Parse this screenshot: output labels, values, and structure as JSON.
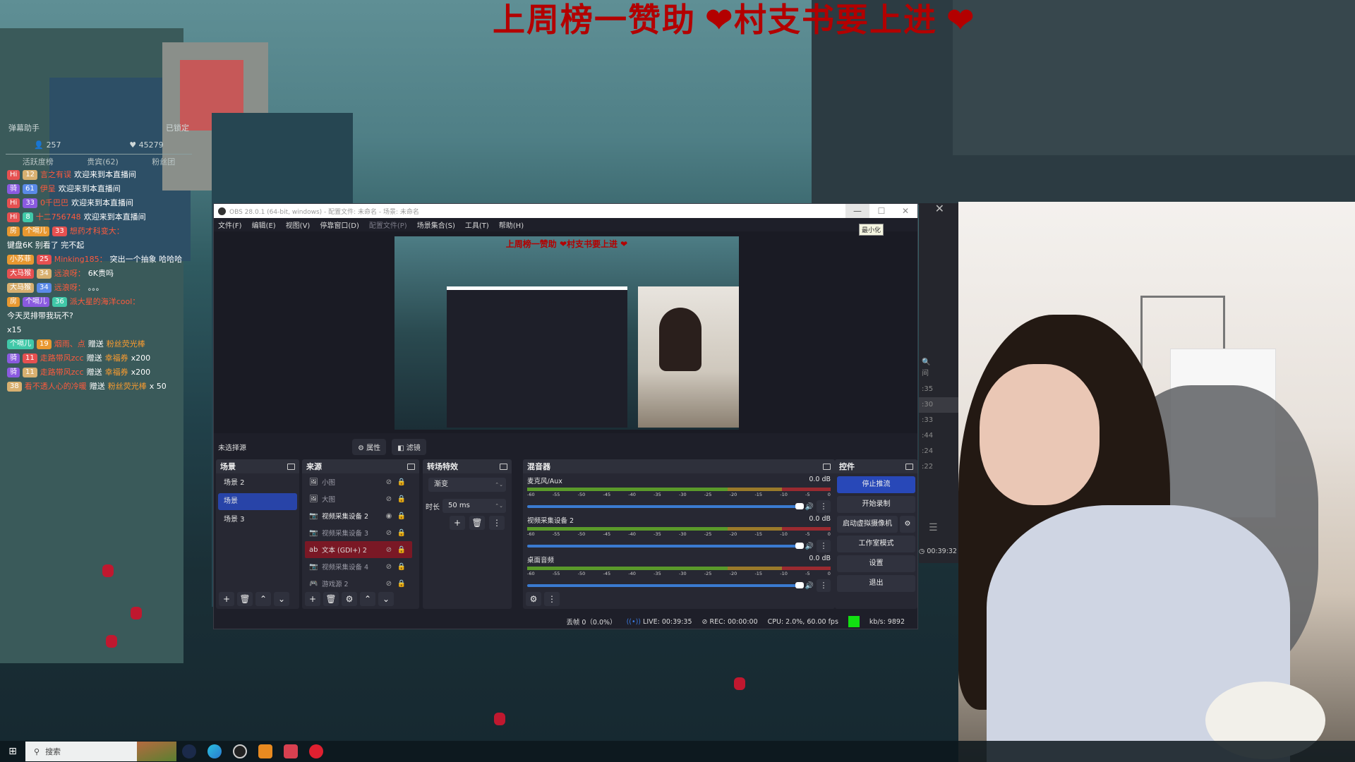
{
  "banner": {
    "text": "上周榜一赞助 ❤村支书要上进 ❤"
  },
  "chat": {
    "title": "弹幕助手",
    "lock_label": "已锁定",
    "stats": {
      "viewers": "257",
      "likes": "45279"
    },
    "tabs": [
      "活跃度榜",
      "贵宾(62)",
      "粉丝团"
    ],
    "messages": [
      {
        "badges": [
          "Hi",
          "12"
        ],
        "nick": "言之有误",
        "text": "欢迎来到本直播间"
      },
      {
        "badges": [
          "骑",
          "61"
        ],
        "nick": "伊呈",
        "text": "欢迎来到本直播间"
      },
      {
        "badges": [
          "Hi",
          "33"
        ],
        "nick": "0千巴巴",
        "text": "欢迎来到本直播间"
      },
      {
        "badges": [
          "Hi",
          "8"
        ],
        "nick": "十二756748",
        "text": "欢迎来到本直播间"
      },
      {
        "badges": [
          "房",
          "个嗝儿",
          "33"
        ],
        "nick": "想药才科变大：",
        "text": "键盘6K 别看了 完不起"
      },
      {
        "badges": [
          "小苏菲",
          "25"
        ],
        "nick": "Minking185：",
        "text": "突出一个抽象 哈哈哈"
      },
      {
        "badges": [
          "大马猴",
          "34"
        ],
        "nick": "远浪呀：",
        "text": "6K贵吗"
      },
      {
        "badges": [
          "大马猴",
          "34"
        ],
        "nick": "远浪呀：",
        "text": "。。。"
      },
      {
        "badges": [
          "房",
          "个嗝儿",
          "36"
        ],
        "nick": "派大星的海洋cool：",
        "text": "今天灵排带我玩不?"
      },
      {
        "badges": [],
        "nick": "",
        "text": "x15"
      },
      {
        "badges": [
          "个嗝儿",
          "19"
        ],
        "nick": "烟雨、点",
        "text": "赠送",
        "gift": "粉丝荧光棒"
      },
      {
        "badges": [
          "骑",
          "11"
        ],
        "nick": "走路带风zcc",
        "text": "赠送",
        "gift": "幸福券",
        "count": "x200"
      },
      {
        "badges": [
          "骑",
          "11"
        ],
        "nick": "走路带风zcc",
        "text": "赠送",
        "gift": "幸福券",
        "count": "x200"
      },
      {
        "badges": [
          "38"
        ],
        "nick": "看不透人心的冷暖",
        "text": "赠送",
        "gift": "粉丝荧光棒",
        "count": "x 50"
      }
    ]
  },
  "obs": {
    "title": "OBS 28.0.1 (64-bit, windows) - 配置文件: 未命名 - 场景: 未命名",
    "window_controls": {
      "minimize": "—",
      "maximize": "☐",
      "close": "✕"
    },
    "tooltip": "最小化",
    "menu": [
      {
        "label": "文件(F)",
        "disabled": false
      },
      {
        "label": "编辑(E)",
        "disabled": false
      },
      {
        "label": "视图(V)",
        "disabled": false
      },
      {
        "label": "停靠窗口(D)",
        "disabled": false
      },
      {
        "label": "配置文件(P)",
        "disabled": true
      },
      {
        "label": "场景集合(S)",
        "disabled": false
      },
      {
        "label": "工具(T)",
        "disabled": false
      },
      {
        "label": "帮助(H)",
        "disabled": false
      }
    ],
    "preview_banner": "上周榜一赞助 ❤村支书要上进 ❤",
    "source_bar": {
      "no_source": "未选择源",
      "properties": "属性",
      "filters": "滤镜"
    },
    "scenes": {
      "title": "场景",
      "items": [
        {
          "label": "场景 2",
          "selected": false
        },
        {
          "label": "场景",
          "selected": true
        },
        {
          "label": "场景 3",
          "selected": false
        }
      ]
    },
    "sources": {
      "title": "来源",
      "items": [
        {
          "icon": "image",
          "label": "小图",
          "visible": false,
          "selected": false
        },
        {
          "icon": "image",
          "label": "大图",
          "visible": false,
          "selected": false
        },
        {
          "icon": "camera",
          "label": "视频采集设备 2",
          "visible": true,
          "selected": false
        },
        {
          "icon": "camera",
          "label": "视频采集设备 3",
          "visible": false,
          "selected": false
        },
        {
          "icon": "text",
          "label": "文本 (GDI+) 2",
          "visible": false,
          "selected": true
        },
        {
          "icon": "camera",
          "label": "视频采集设备 4",
          "visible": false,
          "selected": false
        },
        {
          "icon": "gamepad",
          "label": "游戏源 2",
          "visible": false,
          "selected": false
        }
      ]
    },
    "transitions": {
      "title": "转场特效",
      "type": "渐变",
      "duration_label": "时长",
      "duration": "50 ms"
    },
    "mixer": {
      "title": "混音器",
      "ticks": [
        "-60",
        "-55",
        "-50",
        "-45",
        "-40",
        "-35",
        "-30",
        "-25",
        "-20",
        "-15",
        "-10",
        "-5",
        "0"
      ],
      "channels": [
        {
          "name": "麦克风/Aux",
          "db": "0.0 dB",
          "volume": 1.0
        },
        {
          "name": "视频采集设备 2",
          "db": "0.0 dB",
          "volume": 1.0
        },
        {
          "name": "桌面音频",
          "db": "0.0 dB",
          "volume": 1.0
        }
      ]
    },
    "controls": {
      "title": "控件",
      "stop_stream": "停止推流",
      "start_record": "开始录制",
      "virtual_cam": "启动虚拟摄像机",
      "studio_mode": "工作室模式",
      "settings": "设置",
      "exit": "退出"
    },
    "status": {
      "dropped": "丢帧 0（0.0%）",
      "live": "LIVE: 00:39:35",
      "rec": "REC: 00:00:00",
      "cpu": "CPU: 2.0%, 60.00 fps",
      "bitrate": "kb/s: 9892",
      "indicator_color": "#12e012"
    }
  },
  "side_strip": {
    "items": [
      "间",
      ":35",
      ":30",
      ":33",
      ":44",
      ":24",
      ":22"
    ],
    "selected_index": 2,
    "timer": "00:39:32"
  },
  "taskbar": {
    "search_placeholder": "搜索",
    "apps": [
      "steam",
      "edge",
      "obs",
      "app-orange",
      "app-red",
      "netease-music"
    ]
  }
}
